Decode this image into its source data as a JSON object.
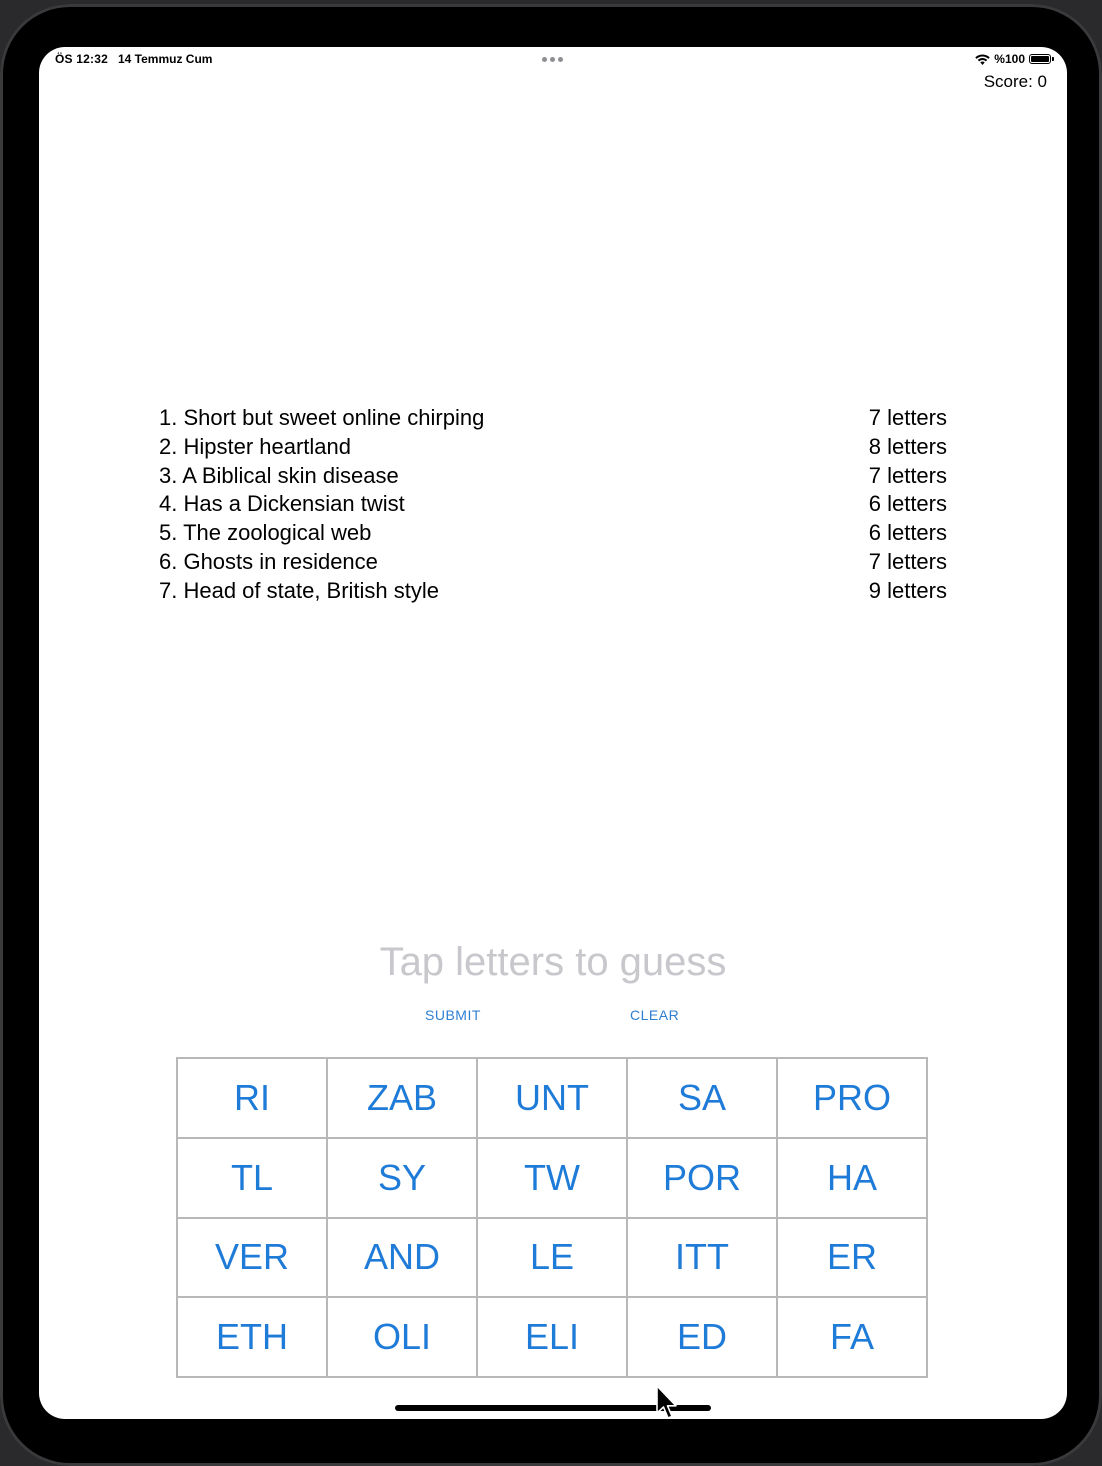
{
  "status_bar": {
    "time": "ÖS 12:32",
    "date": "14 Temmuz Cum",
    "battery_text": "%100"
  },
  "score": "Score: 0",
  "clues": [
    {
      "text": "1. Short but sweet online chirping",
      "length": "7 letters"
    },
    {
      "text": "2. Hipster heartland",
      "length": "8 letters"
    },
    {
      "text": "3. A Biblical skin disease",
      "length": "7 letters"
    },
    {
      "text": "4. Has a Dickensian twist",
      "length": "6 letters"
    },
    {
      "text": "5. The zoological web",
      "length": "6 letters"
    },
    {
      "text": "6. Ghosts in residence",
      "length": "7 letters"
    },
    {
      "text": "7. Head of state, British style",
      "length": "9 letters"
    }
  ],
  "current_answer_placeholder": "Tap letters to guess",
  "buttons": {
    "submit": "SUBMIT",
    "clear": "CLEAR"
  },
  "letter_tiles": [
    "RI",
    "ZAB",
    "UNT",
    "SA",
    "PRO",
    "TL",
    "SY",
    "TW",
    "POR",
    "HA",
    "VER",
    "AND",
    "LE",
    "ITT",
    "ER",
    "ETH",
    "OLI",
    "ELI",
    "ED",
    "FA"
  ],
  "colors": {
    "accent": "#1f7bd8",
    "placeholder": "#c7c7cc",
    "grid_border": "#b8b8b8"
  },
  "icons": {
    "wifi": "wifi-icon",
    "battery": "battery-icon",
    "multitasking": "more-dots-icon",
    "cursor": "pointer-cursor-icon"
  }
}
